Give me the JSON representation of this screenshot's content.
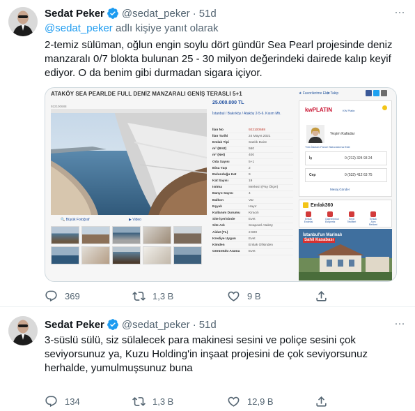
{
  "tweets": [
    {
      "author": "Sedat Peker",
      "handle": "@sedat_peker",
      "separator": "·",
      "time": "51d",
      "more": "···",
      "reply_mention": "@sedat_peker",
      "reply_suffix": " adlı kişiye yanıt olarak",
      "text": "2-temiz sülüman, oğlun engin soylu dört gündür Sea Pearl projesinde deniz manzaralı 0/7 blokta bulunan 25 - 30 milyon değerindeki dairede kalıp keyif ediyor. O da benim gibi durmadan sigara içiyor.",
      "stats": {
        "replies": "369",
        "retweets": "1,3 B",
        "likes": "9 B"
      }
    },
    {
      "author": "Sedat Peker",
      "handle": "@sedat_peker",
      "separator": "·",
      "time": "51d",
      "more": "···",
      "text": "3-süslü sülü, siz sülalecek para makinesi sesini ve poliçe sesini çok seviyorsunuz ya, Kuzu Holding'in inşaat projesini de çok seviyorsunuz herhalde, yumulmuşsunuz buna",
      "stats": {
        "replies": "134",
        "retweets": "1,3 B",
        "likes": "12,9 B"
      }
    }
  ],
  "listing": {
    "title": "ATAKÖY SEA PEARLDE FULL DENİZ MANZARALI GENİŞ TERASLI 5+1",
    "favorite": "★ Favorilerime Ekle",
    "compare": "⇄ Takip",
    "listing_no_small": "922100688",
    "price": "25.000.000 TL",
    "location": "İstanbul / Bakırköy / Ataköy 2-5-6. Kısım Mh.",
    "big_photo": "🔍 Büyük Fotoğraf",
    "video": "▶ Video",
    "rows": [
      {
        "k": "İlan No",
        "v": "922100688"
      },
      {
        "k": "İlan Tarihi",
        "v": "24 Mayıs 2021"
      },
      {
        "k": "Emlak Tipi",
        "v": "Satılık Daire"
      },
      {
        "k": "m² (Brüt)",
        "v": "560"
      },
      {
        "k": "m² (Net)",
        "v": "400"
      },
      {
        "k": "Oda Sayısı",
        "v": "5+1"
      },
      {
        "k": "Bina Yaşı",
        "v": "2"
      },
      {
        "k": "Bulunduğu Kat",
        "v": "9"
      },
      {
        "k": "Kat Sayısı",
        "v": "19"
      },
      {
        "k": "Isıtma",
        "v": "Merkezi (Pay Ölçer)"
      },
      {
        "k": "Banyo Sayısı",
        "v": "4"
      },
      {
        "k": "Balkon",
        "v": "Var"
      },
      {
        "k": "Eşyalı",
        "v": "Hayır"
      },
      {
        "k": "Kullanım Durumu",
        "v": "Kiracılı"
      },
      {
        "k": "Site İçerisinde",
        "v": "Evet"
      },
      {
        "k": "Site Adı",
        "v": "Seapearl Ataköy"
      },
      {
        "k": "Aidat (TL)",
        "v": "2.500"
      },
      {
        "k": "Krediye Uygun",
        "v": "Evet"
      },
      {
        "k": "Kimden",
        "v": "Emlak Ofisinden"
      },
      {
        "k": "Görüntülü Arama",
        "v": "Evet"
      }
    ],
    "agent": {
      "brand": "kwPLATIN",
      "brand_sub": "KW Platin",
      "name": "Yeşim Kafadar",
      "tabs": "Tüm İlanları    Favori Satıcılarıma Ekle",
      "work_label": "İş",
      "work_phone": "0 (212) 324 93 24",
      "mobile_label": "Cep",
      "mobile_phone": "0 (532) 412 63 75",
      "message": "Mesaj Gönder"
    },
    "emlak360": {
      "label": "Emlak360",
      "items": [
        "Emlak Endeksi",
        "Gayrimenkul Ekspertiz",
        "Kredi Teklifleri",
        "Emlak Alım Rehberi"
      ]
    },
    "ad": {
      "line1": "İstanbul'un Marinalı",
      "line2": "Sahil Kasabası"
    }
  },
  "colors": {
    "accent": "#1d9bf0",
    "muted": "#536471",
    "text": "#0f1419",
    "border": "#eff3f4"
  }
}
